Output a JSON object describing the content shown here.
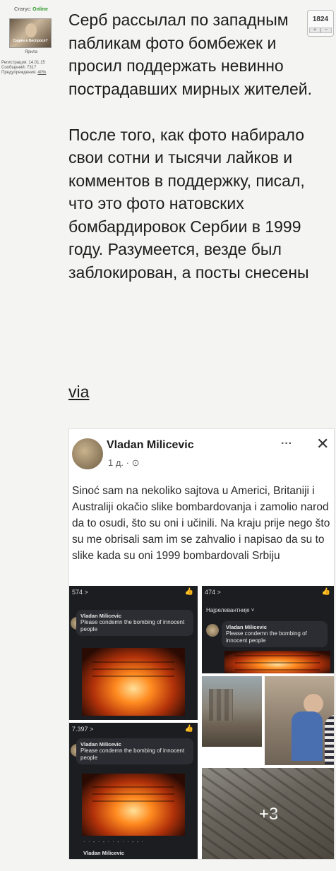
{
  "user": {
    "status_label": "Статус:",
    "status_value": "Online",
    "avatar_caption": "Сидим в Беспросе?",
    "username": "Ярила",
    "registration": "Регистрация: 14.01.15",
    "messages": "Сообщений: 7317",
    "warnings_label": "Предупреждения:",
    "warnings_value": "40%"
  },
  "rating": {
    "count": "1824",
    "plus": "+",
    "minus": "−"
  },
  "post": {
    "paragraph1": "Серб рассылал по западным пабликам фото бомбежек и просил поддержать невинно пострадавших мирных жителей.",
    "paragraph2": "После того, как фото набирало свои сотни и тысячи лайков и комментов в поддержку, писал, что это фото натовских бомбардировок Сербии в 1999 году. Разумеется, везде был заблокирован, а посты снесены",
    "link": "via"
  },
  "fb_post": {
    "author": "Vladan Milicevic",
    "time": "1 д. ·",
    "more_label": "···",
    "close_label": "✕",
    "message": "Sinoć sam na nekoliko sajtova u Americi, Britaniji i Australiji okačio slike bombardovanja i zamolio narod da to osudi, što su oni i učinili. Na kraju prije nego što su me obrisali sam im se zahvalio i napisao da su to slike kada su oni 1999 bombardovali Srbiju",
    "screens": [
      {
        "count": "574 >",
        "commenter": "Vladan Milicevic",
        "comment": "Please condemn the bombing of innocent people"
      },
      {
        "count": "474 >",
        "sort": "Најрелевантније ˅",
        "commenter": "Vladan Milicevic",
        "comment": "Please condemn the bombing of innocent people"
      },
      {
        "count": "7.397 >",
        "commenter": "Vladan Milicevic",
        "comment": "Please condemn the bombing of innocent people",
        "blurred": "· · - · - · · - · · - - ·",
        "footer_name": "Vladan Milicevic"
      }
    ],
    "more_photos": "+3"
  },
  "colors": {
    "background": "#f4f4f2",
    "online": "#2e9a2e",
    "text": "#1c1c1c"
  }
}
